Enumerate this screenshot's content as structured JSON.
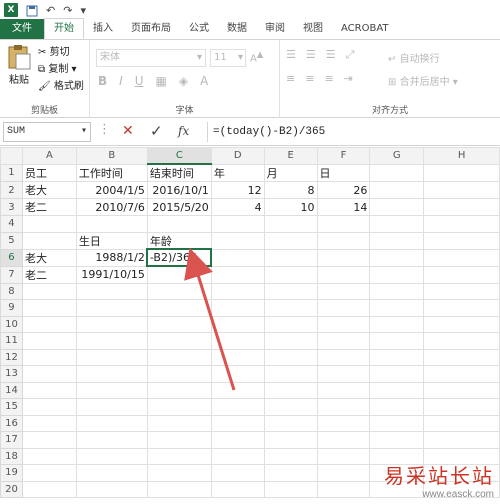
{
  "qat": {
    "app_icon": "X",
    "undo": "↶",
    "redo": "↷"
  },
  "tabs": [
    "文件",
    "开始",
    "插入",
    "页面布局",
    "公式",
    "数据",
    "审阅",
    "视图",
    "ACROBAT"
  ],
  "ribbon": {
    "paste": "粘贴",
    "cut": "剪切",
    "copy": "复制",
    "format_painter": "格式刷",
    "clipboard_group": "剪贴板",
    "font_name": "宋体",
    "font_size": "11",
    "font_group": "字体",
    "bold": "B",
    "italic": "I",
    "underline": "U",
    "wrap_text": "自动换行",
    "merge_center": "合并后居中",
    "align_group": "对齐方式"
  },
  "formula_bar": {
    "name_box": "SUM",
    "cancel": "✕",
    "confirm": "✓",
    "fx": "fx",
    "formula": "=(today()-B2)/365"
  },
  "grid": {
    "columns": [
      "A",
      "B",
      "C",
      "D",
      "E",
      "F",
      "G",
      "H"
    ],
    "rows": [
      [
        "员工",
        "工作时间",
        "结束时间",
        "年",
        "月",
        "日",
        "",
        ""
      ],
      [
        "老大",
        "2004/1/5",
        "2016/10/1",
        "12",
        "8",
        "26",
        "",
        ""
      ],
      [
        "老二",
        "2010/7/6",
        "2015/5/20",
        "4",
        "10",
        "14",
        "",
        ""
      ],
      [
        "",
        "",
        "",
        "",
        "",
        "",
        "",
        ""
      ],
      [
        "",
        "生日",
        "年龄",
        "",
        "",
        "",
        "",
        ""
      ],
      [
        "老大",
        "1988/1/2",
        "-B2)/365",
        "",
        "",
        "",
        "",
        ""
      ],
      [
        "老二",
        "1991/10/15",
        "",
        "",
        "",
        "",
        "",
        ""
      ],
      [
        "",
        "",
        "",
        "",
        "",
        "",
        "",
        ""
      ],
      [
        "",
        "",
        "",
        "",
        "",
        "",
        "",
        ""
      ],
      [
        "",
        "",
        "",
        "",
        "",
        "",
        "",
        ""
      ],
      [
        "",
        "",
        "",
        "",
        "",
        "",
        "",
        ""
      ],
      [
        "",
        "",
        "",
        "",
        "",
        "",
        "",
        ""
      ],
      [
        "",
        "",
        "",
        "",
        "",
        "",
        "",
        ""
      ],
      [
        "",
        "",
        "",
        "",
        "",
        "",
        "",
        ""
      ],
      [
        "",
        "",
        "",
        "",
        "",
        "",
        "",
        ""
      ],
      [
        "",
        "",
        "",
        "",
        "",
        "",
        "",
        ""
      ],
      [
        "",
        "",
        "",
        "",
        "",
        "",
        "",
        ""
      ],
      [
        "",
        "",
        "",
        "",
        "",
        "",
        "",
        ""
      ],
      [
        "",
        "",
        "",
        "",
        "",
        "",
        "",
        ""
      ],
      [
        "",
        "",
        "",
        "",
        "",
        "",
        "",
        ""
      ]
    ],
    "row_numbers": [
      "1",
      "2",
      "3",
      "4",
      "5",
      "6",
      "7",
      "8",
      "9",
      "10",
      "11",
      "12",
      "13",
      "14",
      "15",
      "16",
      "17",
      "18",
      "19",
      "20"
    ]
  },
  "watermark": {
    "line1": "易采站长站",
    "line2": "www.easck.com"
  },
  "colors": {
    "accent": "#217346",
    "arrow": "#d9534f"
  }
}
